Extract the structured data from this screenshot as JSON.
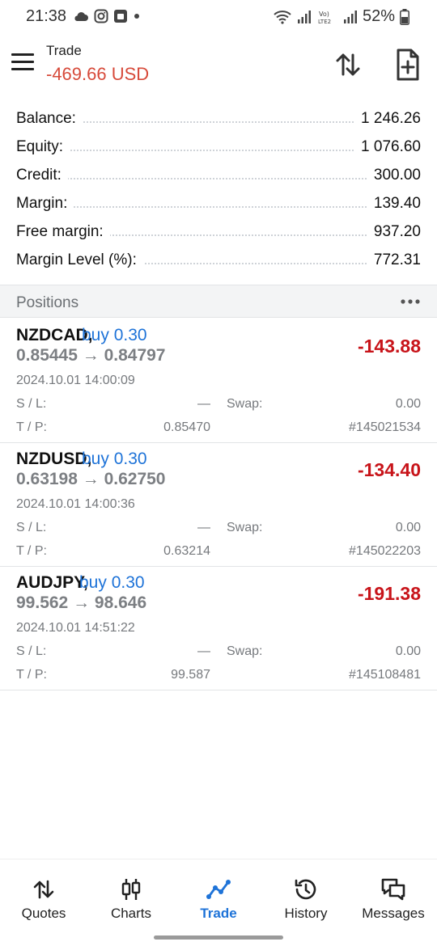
{
  "status_bar": {
    "time": "21:38",
    "battery": "52%",
    "icons_left": [
      "cloud-icon",
      "instagram-icon",
      "app-icon",
      "dot-icon"
    ],
    "icons_right": [
      "wifi-icon",
      "signal-icon",
      "volte-icon",
      "signal-icon",
      "battery-icon"
    ]
  },
  "header": {
    "title": "Trade",
    "profit": "-469.66 USD",
    "profit_color": "#d74a3a"
  },
  "summary": [
    {
      "label": "Balance:",
      "value": "1 246.26"
    },
    {
      "label": "Equity:",
      "value": "1 076.60"
    },
    {
      "label": "Credit:",
      "value": "300.00"
    },
    {
      "label": "Margin:",
      "value": "139.40"
    },
    {
      "label": "Free margin:",
      "value": "937.20"
    },
    {
      "label": "Margin Level (%):",
      "value": "772.31"
    }
  ],
  "positions_header": {
    "title": "Positions"
  },
  "positions": [
    {
      "symbol": "NZDCAD,",
      "type": "buy 0.30",
      "prices": "0.85445 → 0.84797",
      "profit": "-143.88",
      "time": "2024.10.01 14:00:09",
      "sl_label": "S / L:",
      "sl_value": "—",
      "swap_label": "Swap:",
      "swap_value": "0.00",
      "tp_label": "T / P:",
      "tp_value": "0.85470",
      "ticket": "#145021534"
    },
    {
      "symbol": "NZDUSD,",
      "type": "buy 0.30",
      "prices": "0.63198 → 0.62750",
      "profit": "-134.40",
      "time": "2024.10.01 14:00:36",
      "sl_label": "S / L:",
      "sl_value": "—",
      "swap_label": "Swap:",
      "swap_value": "0.00",
      "tp_label": "T / P:",
      "tp_value": "0.63214",
      "ticket": "#145022203"
    },
    {
      "symbol": "AUDJPY,",
      "type": "buy 0.30",
      "prices": "99.562 → 98.646",
      "profit": "-191.38",
      "time": "2024.10.01 14:51:22",
      "sl_label": "S / L:",
      "sl_value": "—",
      "swap_label": "Swap:",
      "swap_value": "0.00",
      "tp_label": "T / P:",
      "tp_value": "99.587",
      "ticket": "#145108481"
    }
  ],
  "colors": {
    "accent": "#1e73d8",
    "loss": "#c8141a"
  },
  "bottom_nav": [
    {
      "label": "Quotes",
      "icon": "quotes-arrows-icon",
      "active": false
    },
    {
      "label": "Charts",
      "icon": "candlestick-icon",
      "active": false
    },
    {
      "label": "Trade",
      "icon": "trade-line-icon",
      "active": true
    },
    {
      "label": "History",
      "icon": "history-clock-icon",
      "active": false
    },
    {
      "label": "Messages",
      "icon": "messages-icon",
      "active": false
    }
  ]
}
